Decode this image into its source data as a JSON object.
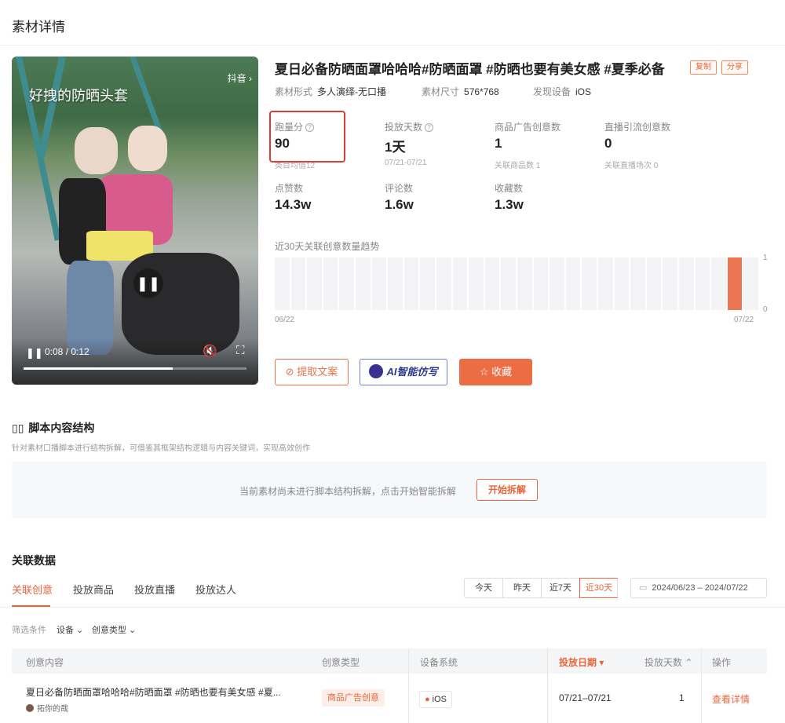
{
  "page": {
    "title": "素材详情"
  },
  "video": {
    "caption": "好拽的防晒头套",
    "platform": "抖音 ›",
    "current_time": "0:08",
    "duration": "0:12",
    "time_text": "0:08 / 0:12",
    "progress": 0.67
  },
  "material": {
    "title": "夏日必备防晒面罩哈哈哈#防晒面罩 #防晒也要有美女感 #夏季必备",
    "copy_label": "复制",
    "share_label": "分享",
    "meta": [
      {
        "key": "素材形式",
        "value": "多人演绎-无口播"
      },
      {
        "key": "素材尺寸",
        "value": "576*768"
      },
      {
        "key": "发现设备",
        "value": "iOS"
      }
    ]
  },
  "stats": {
    "score": {
      "label": "跑量分",
      "value": "90",
      "sub": "类目均值12"
    },
    "days": {
      "label": "投放天数",
      "value": "1天",
      "sub": "07/21-07/21"
    },
    "product_ads": {
      "label": "商品广告创意数",
      "value": "1",
      "sub": "关联商品数 1"
    },
    "live_ads": {
      "label": "直播引流创意数",
      "value": "0",
      "sub": "关联直播场次 0"
    },
    "likes": {
      "label": "点赞数",
      "value": "14.3w"
    },
    "comments": {
      "label": "评论数",
      "value": "1.6w"
    },
    "favorites": {
      "label": "收藏数",
      "value": "1.3w"
    }
  },
  "chart_data": {
    "type": "bar",
    "title": "近30天关联创意数量趋势",
    "x_start": "06/22",
    "x_end": "07/22",
    "ylim": [
      0,
      1
    ],
    "y_ticks": [
      "1",
      "0"
    ],
    "values": [
      0,
      0,
      0,
      0,
      0,
      0,
      0,
      0,
      0,
      0,
      0,
      0,
      0,
      0,
      0,
      0,
      0,
      0,
      0,
      0,
      0,
      0,
      0,
      0,
      0,
      0,
      0,
      0,
      1,
      0
    ]
  },
  "actions": {
    "extract": "提取文案",
    "ai": "AI智能仿写",
    "collect": "收藏"
  },
  "script_section": {
    "title": "脚本内容结构",
    "desc": "针对素材口播脚本进行结构拆解，可借鉴其框架结构逻辑与内容关键词，实现高效创作",
    "empty_text": "当前素材尚未进行脚本结构拆解，点击开始智能拆解",
    "start_label": "开始拆解"
  },
  "related": {
    "title": "关联数据",
    "tabs": [
      "关联创意",
      "投放商品",
      "投放直播",
      "投放达人"
    ],
    "ranges": [
      "今天",
      "昨天",
      "近7天",
      "近30天"
    ],
    "date_range": "2024/06/23 – 2024/07/22",
    "filter_label": "筛选条件",
    "filter_device": "设备 ⌄",
    "filter_type": "创意类型 ⌄",
    "columns": [
      "创意内容",
      "创意类型",
      "设备系统",
      "投放日期 ▾",
      "投放天数 ⌃",
      "操作"
    ],
    "row": {
      "content": "夏日必备防晒面罩哈哈哈#防晒面罩 #防晒也要有美女感 #夏...",
      "author": "拓你的哉",
      "type": "商品广告创意",
      "os": "iOS",
      "date": "07/21–07/21",
      "days": "1",
      "action": "查看详情"
    }
  },
  "colors": {
    "accent": "#e8663a",
    "highlight_box": "#d7403a",
    "trend_bar": "#ec7651"
  }
}
